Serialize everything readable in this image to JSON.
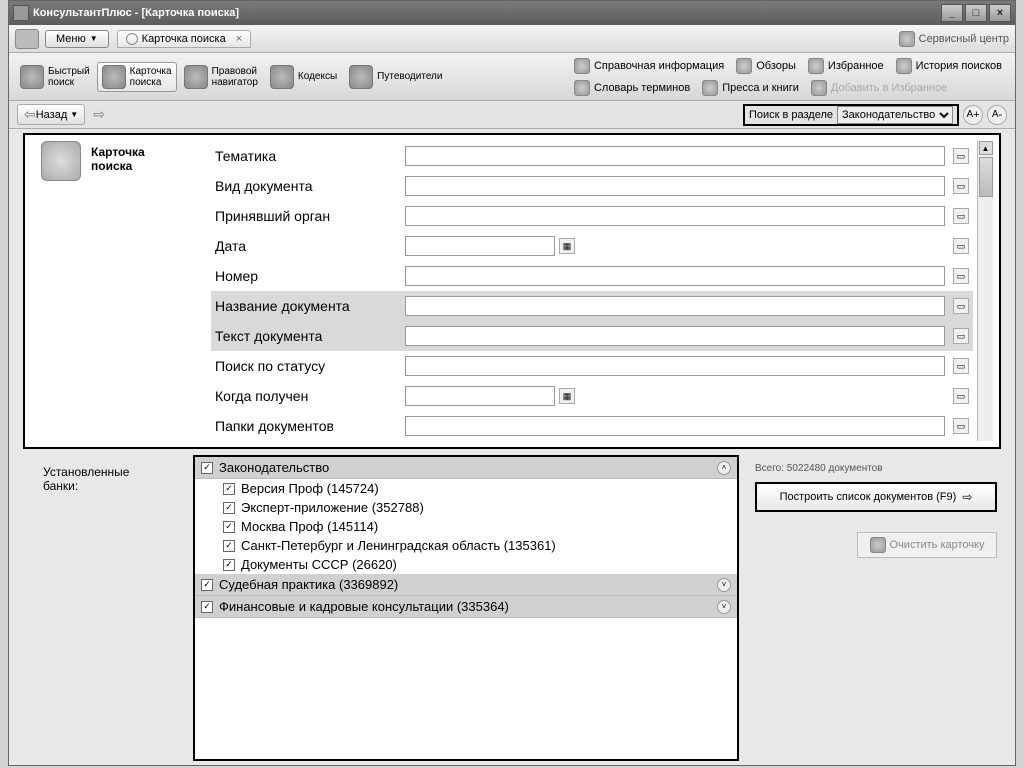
{
  "title": "КонсультантПлюс - [Карточка поиска]",
  "menu_button": "Меню",
  "tab_label": "Карточка поиска",
  "service_center": "Сервисный центр",
  "toolbar": [
    {
      "label": "Быстрый\nпоиск",
      "name": "quick-search"
    },
    {
      "label": "Карточка\nпоиска",
      "name": "search-card",
      "selected": true
    },
    {
      "label": "Правовой\nнавигатор",
      "name": "legal-navigator"
    },
    {
      "label": "Кодексы",
      "name": "codexes"
    },
    {
      "label": "Путеводители",
      "name": "guides"
    }
  ],
  "toolbar_right": {
    "row1": [
      {
        "label": "Справочная информация",
        "name": "reference-info"
      },
      {
        "label": "Обзоры",
        "name": "reviews"
      },
      {
        "label": "Избранное",
        "name": "favorites"
      },
      {
        "label": "История поисков",
        "name": "search-history"
      }
    ],
    "row2": [
      {
        "label": "Словарь терминов",
        "name": "glossary"
      },
      {
        "label": "Пресса и книги",
        "name": "press"
      },
      {
        "label": "Добавить в Избранное",
        "name": "add-favorite"
      }
    ]
  },
  "nav_back": "Назад",
  "section_label": "Поиск в разделе",
  "section_value": "Законодательство",
  "card_title": "Карточка\nпоиска",
  "fields": [
    {
      "label": "Тематика",
      "name": "topic",
      "long": true
    },
    {
      "label": "Вид документа",
      "name": "doc-type",
      "long": true
    },
    {
      "label": "Принявший орган",
      "name": "authority",
      "long": true
    },
    {
      "label": "Дата",
      "name": "date",
      "short": true
    },
    {
      "label": "Номер",
      "name": "number",
      "long": true
    },
    {
      "label": "Название документа",
      "name": "doc-title",
      "long": true,
      "hl": true
    },
    {
      "label": "Текст документа",
      "name": "doc-text",
      "long": true,
      "hl": true
    },
    {
      "label": "Поиск по статусу",
      "name": "status",
      "long": true
    },
    {
      "label": "Когда получен",
      "name": "received",
      "short": true
    },
    {
      "label": "Папки документов",
      "name": "folders",
      "long": true
    }
  ],
  "banks_label": "Установленные\nбанки:",
  "banks": {
    "group1": {
      "label": "Законодательство",
      "items": [
        {
          "label": "Версия Проф (145724)"
        },
        {
          "label": "Эксперт-приложение (352788)"
        },
        {
          "label": "Москва Проф (145114)"
        },
        {
          "label": "Санкт-Петербург и Ленинградская область (135361)"
        },
        {
          "label": "Документы СССР (26620)"
        }
      ]
    },
    "group2": {
      "label": "Судебная практика (3369892)"
    },
    "group3": {
      "label": "Финансовые и кадровые консультации (335364)"
    }
  },
  "total_label": "Всего: 5022480 документов",
  "build_button": "Построить список документов (F9)",
  "clear_button": "Очистить карточку"
}
